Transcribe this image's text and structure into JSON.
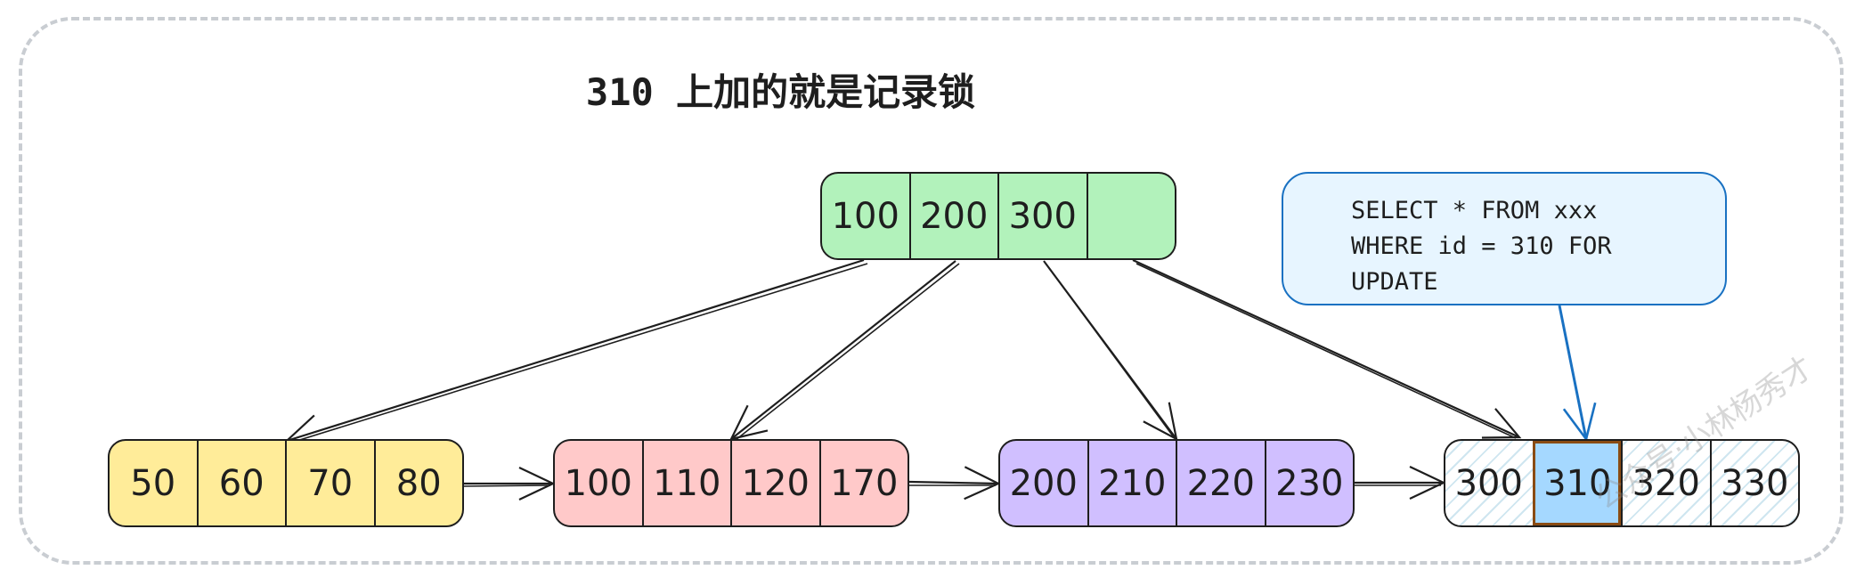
{
  "diagram": {
    "title": "310 上加的就是记录锁",
    "root_node": [
      "100",
      "200",
      "300",
      ""
    ],
    "leaf_nodes": [
      [
        "50",
        "60",
        "70",
        "80"
      ],
      [
        "100",
        "110",
        "120",
        "170"
      ],
      [
        "200",
        "210",
        "220",
        "230"
      ],
      [
        "300",
        "310",
        "320",
        "330"
      ]
    ],
    "locked_record": "310",
    "sql": {
      "line1": "SELECT * FROM xxx",
      "line2": "WHERE id = 310 FOR",
      "line3": "UPDATE"
    },
    "watermark": "公众号·小林杨秀才",
    "colors": {
      "root": "#b2f2bb",
      "leaf_1": "#ffec99",
      "leaf_2": "#ffc9c9",
      "leaf_3": "#d0bfff",
      "locked": "#a5d8ff",
      "callout": "#e7f5ff",
      "callout_stroke": "#1971c2"
    }
  }
}
